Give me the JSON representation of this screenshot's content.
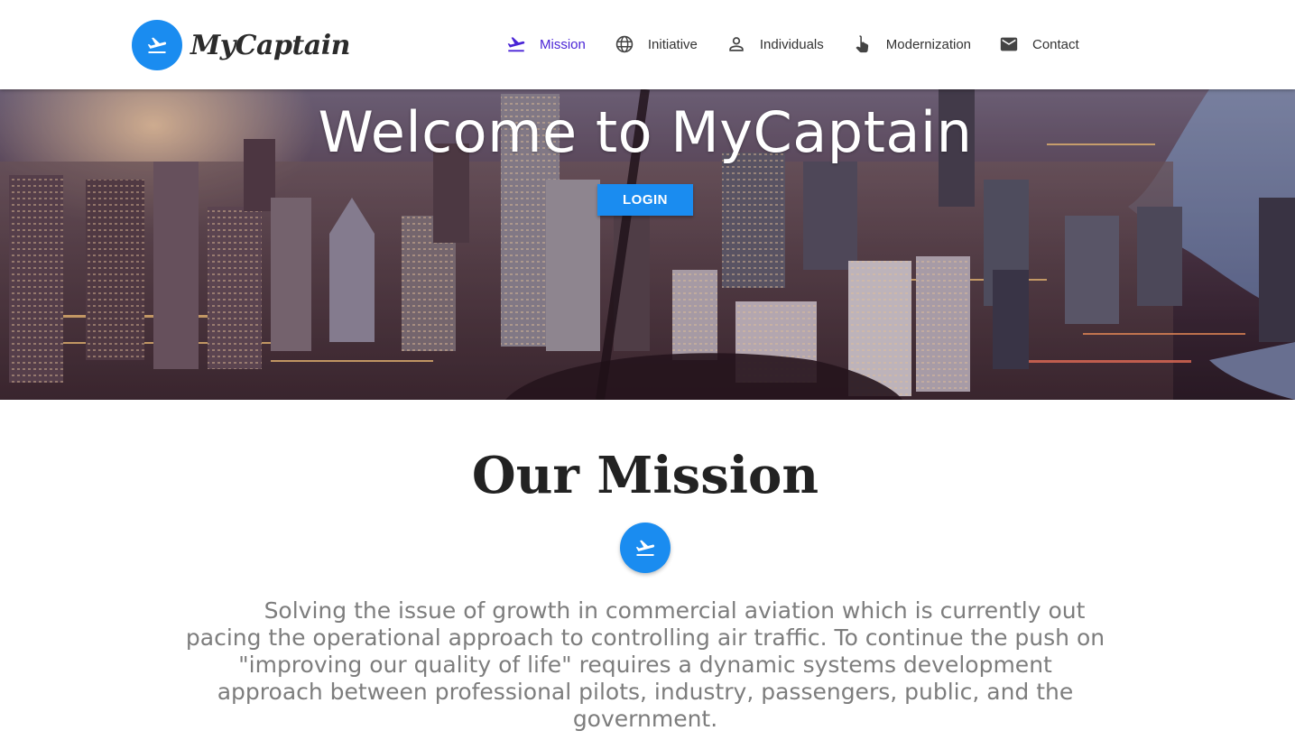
{
  "brand": {
    "name": "MyCaptain",
    "icon": "airplane-takeoff-icon",
    "accent": "#1a8cf0"
  },
  "nav": {
    "items": [
      {
        "label": "Mission",
        "icon": "flight-takeoff-icon",
        "active": true
      },
      {
        "label": "Initiative",
        "icon": "globe-icon",
        "active": false
      },
      {
        "label": "Individuals",
        "icon": "person-icon",
        "active": false
      },
      {
        "label": "Modernization",
        "icon": "touch-hand-icon",
        "active": false
      },
      {
        "label": "Contact",
        "icon": "mail-icon",
        "active": false
      }
    ],
    "active_color": "#4a25d6"
  },
  "hero": {
    "title": "Welcome to MyCaptain",
    "login_label": "LOGIN"
  },
  "mission": {
    "title": "Our Mission",
    "icon": "flight-takeoff-icon",
    "text": "Solving the issue of growth in commercial aviation which is currently out pacing the operational approach to controlling air traffic. To continue the push on \"improving our quality of life\" requires a dynamic systems development approach between professional pilots, industry, passengers, public, and the government."
  }
}
